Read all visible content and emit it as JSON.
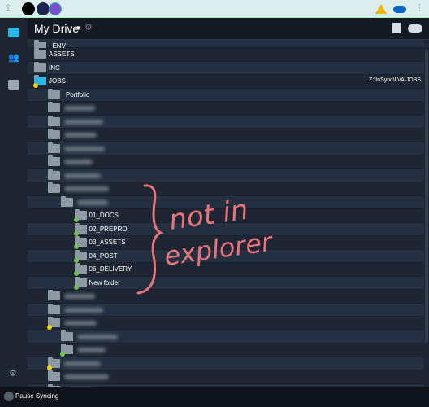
{
  "header": {
    "title": "My Drive"
  },
  "rows": [
    {
      "name": "_ENV",
      "depth": 0,
      "badge": "green"
    },
    {
      "name": "ASSETS",
      "depth": 0
    },
    {
      "name": "INC",
      "depth": 0
    },
    {
      "name": "JOBS",
      "depth": 0,
      "badge": "yellow",
      "synced": true,
      "path": "Z:\\InSync\\LVA\\JOBS"
    },
    {
      "name": "_Portfolio",
      "depth": 1
    },
    {
      "name": "",
      "depth": 1,
      "blurred": true
    },
    {
      "name": "",
      "depth": 1,
      "blurred": true
    },
    {
      "name": "",
      "depth": 1,
      "blurred": true
    },
    {
      "name": "",
      "depth": 1,
      "blurred": true
    },
    {
      "name": "",
      "depth": 1,
      "blurred": true
    },
    {
      "name": "",
      "depth": 1,
      "blurred": true
    },
    {
      "name": "",
      "depth": 1,
      "blurred": true
    },
    {
      "name": "",
      "depth": 2,
      "blurred": true
    },
    {
      "name": "01_DOCS",
      "depth": 3,
      "badge": "green"
    },
    {
      "name": "02_PREPRO",
      "depth": 3,
      "badge": "green"
    },
    {
      "name": "03_ASSETS",
      "depth": 3,
      "badge": "green"
    },
    {
      "name": "04_POST",
      "depth": 3,
      "badge": "green"
    },
    {
      "name": "06_DELIVERY",
      "depth": 3,
      "badge": "green"
    },
    {
      "name": "New folder",
      "depth": 3,
      "badge": "green"
    },
    {
      "name": "",
      "depth": 1,
      "blurred": true
    },
    {
      "name": "",
      "depth": 1,
      "blurred": true
    },
    {
      "name": "",
      "depth": 1,
      "blurred": true,
      "badge": "yellow"
    },
    {
      "name": "",
      "depth": 2,
      "blurred": true
    },
    {
      "name": "",
      "depth": 2,
      "blurred": true,
      "badge": "green"
    },
    {
      "name": "",
      "depth": 1,
      "blurred": true,
      "badge": "yellow"
    },
    {
      "name": "",
      "depth": 1,
      "blurred": true
    },
    {
      "name": "",
      "depth": 1,
      "blurred": true
    }
  ],
  "annotation": {
    "line1": "not in",
    "line2": "explorer",
    "color": "#e8737a"
  },
  "footer": {
    "pause_label": "Pause Syncing"
  },
  "colors": {
    "green": "#6cc24a",
    "yellow": "#f5d000",
    "accent": "#29b6e8"
  }
}
